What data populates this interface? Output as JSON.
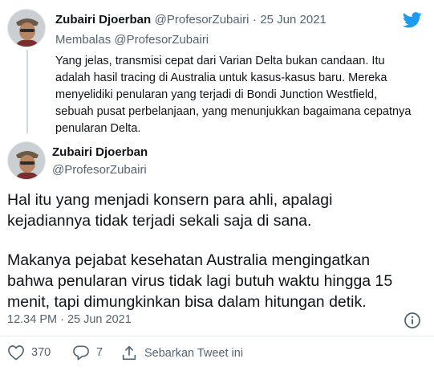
{
  "colors": {
    "accent": "#1d9bf0",
    "muted": "#536471",
    "text": "#0f1419"
  },
  "reply_tweet": {
    "author_name": "Zubairi Djoerban",
    "handle": "@ProfesorZubairi",
    "separator": "·",
    "date": "25 Jun 2021",
    "replying_prefix": "Membalas",
    "replying_handle": "@ProfesorZubairi",
    "text": "Yang jelas, transmisi cepat dari Varian Delta bukan candaan. Itu adalah hasil tracing di Australia untuk kasus-kasus baru. Mereka menyelidiki penularan yang terjadi di Bondi Junction Westfield, sebuah pusat perbelanjaan, yang menunjukkan bagaimana cepatnya penularan Delta."
  },
  "main_tweet": {
    "author_name": "Zubairi Djoerban",
    "handle": "@ProfesorZubairi",
    "paragraph1": "Hal itu yang menjadi konsern para ahli, apalagi kejadiannya tidak terjadi sekali saja di sana.",
    "paragraph2": "Makanya pejabat kesehatan Australia mengingatkan bahwa penularan virus tidak lagi butuh waktu hingga 15 menit, tapi dimungkinkan bisa dalam hitungan detik.",
    "timestamp": "12.34 PM · 25 Jun 2021",
    "likes": "370",
    "replies": "7",
    "share_label": "Sebarkan Tweet ini"
  },
  "icons": {
    "brand": "twitter-bird-icon",
    "info": "info-icon",
    "like": "heart-icon",
    "reply": "reply-icon",
    "share": "share-icon"
  }
}
